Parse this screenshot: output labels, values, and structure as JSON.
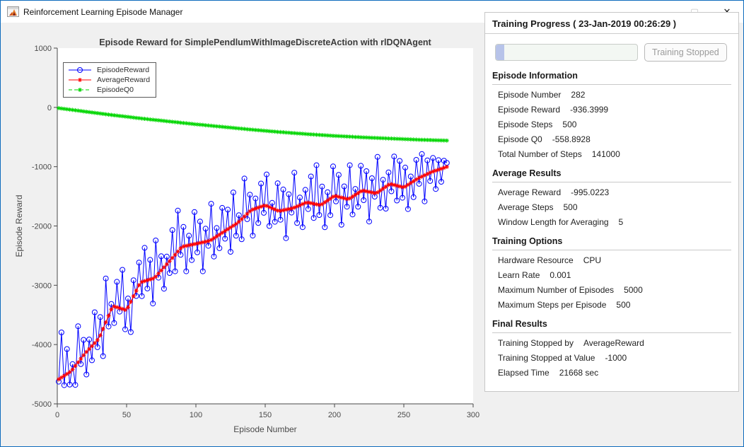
{
  "window": {
    "title": "Reinforcement Learning Episode Manager",
    "controls": {
      "minimize": "—",
      "maximize": "▢",
      "close": "✕"
    }
  },
  "chart_data": {
    "type": "line",
    "title": "Episode Reward for SimplePendlumWithImageDiscreteAction with rlDQNAgent",
    "xlabel": "Episode Number",
    "ylabel": "Episode Reward",
    "xlim": [
      0,
      300
    ],
    "ylim": [
      -5000,
      1000
    ],
    "xticks": [
      0,
      50,
      100,
      150,
      200,
      250,
      300
    ],
    "yticks": [
      1000,
      0,
      -1000,
      -2000,
      -3000,
      -4000,
      -5000
    ],
    "legend_position": "top-left",
    "x_start": 1,
    "x_step": 2,
    "series": [
      {
        "name": "EpisodeReward",
        "color": "#0000ff",
        "marker": "circle",
        "line": "solid",
        "values": [
          -4625,
          -3795,
          -4685,
          -4075,
          -4675,
          -4330,
          -4680,
          -3690,
          -4330,
          -3920,
          -4505,
          -3915,
          -4265,
          -3455,
          -4045,
          -3535,
          -4195,
          -2885,
          -3695,
          -3315,
          -3637,
          -2941,
          -3445,
          -2739,
          -3743,
          -3223,
          -3789,
          -2915,
          -3181,
          -2617,
          -3183,
          -2369,
          -3055,
          -2571,
          -3307,
          -2244,
          -2872,
          -2510,
          -3058,
          -2516,
          -2793,
          -2069,
          -2765,
          -1741,
          -2487,
          -2015,
          -2765,
          -2165,
          -2575,
          -1765,
          -2445,
          -1925,
          -2765,
          -2045,
          -2335,
          -1625,
          -2515,
          -2035,
          -2375,
          -1695,
          -2215,
          -1725,
          -2435,
          -1435,
          -2165,
          -1818,
          -2224,
          -1200,
          -1886,
          -1472,
          -2162,
          -1536,
          -1950,
          -1284,
          -1778,
          -1130,
          -2000,
          -1610,
          -1930,
          -1280,
          -1895,
          -1385,
          -2205,
          -1465,
          -1775,
          -1100,
          -1950,
          -1520,
          -2020,
          -1390,
          -1715,
          -1165,
          -1865,
          -975,
          -1815,
          -1334,
          -2022,
          -1430,
          -1818,
          -996,
          -1586,
          -1138,
          -1980,
          -1332,
          -1674,
          -975,
          -1805,
          -1375,
          -1675,
          -985,
          -1565,
          -1075,
          -1925,
          -1195,
          -1505,
          -834,
          -1692,
          -1220,
          -1708,
          -1096,
          -1416,
          -828,
          -1570,
          -902,
          -1524,
          -1015,
          -1715,
          -1165,
          -1515,
          -885,
          -1289,
          -787,
          -1585,
          -893,
          -1241,
          -852,
          -1376,
          -890,
          -1255,
          -899,
          -936
        ]
      },
      {
        "name": "AverageReward",
        "color": "#ff0000",
        "marker": "asterisk",
        "line": "solid",
        "values": [
          -4585,
          -4555,
          -4525,
          -4495,
          -4465,
          -4420,
          -4360,
          -4300,
          -4240,
          -4180,
          -4125,
          -4075,
          -4025,
          -3975,
          -3925,
          -3845,
          -3735,
          -3625,
          -3515,
          -3405,
          -3357,
          -3371,
          -3385,
          -3399,
          -3413,
          -3373,
          -3279,
          -3185,
          -3091,
          -2997,
          -2943,
          -2929,
          -2915,
          -2901,
          -2887,
          -2854,
          -2802,
          -2750,
          -2698,
          -2646,
          -2593,
          -2539,
          -2485,
          -2431,
          -2377,
          -2345,
          -2335,
          -2325,
          -2315,
          -2305,
          -2295,
          -2285,
          -2275,
          -2265,
          -2255,
          -2235,
          -2205,
          -2175,
          -2145,
          -2115,
          -2085,
          -2055,
          -2025,
          -1995,
          -1965,
          -1928,
          -1884,
          -1840,
          -1796,
          -1752,
          -1722,
          -1706,
          -1690,
          -1674,
          -1658,
          -1660,
          -1680,
          -1700,
          -1720,
          -1740,
          -1745,
          -1735,
          -1725,
          -1715,
          -1705,
          -1690,
          -1670,
          -1650,
          -1630,
          -1610,
          -1605,
          -1615,
          -1625,
          -1635,
          -1645,
          -1634,
          -1602,
          -1570,
          -1538,
          -1506,
          -1496,
          -1508,
          -1520,
          -1532,
          -1544,
          -1535,
          -1505,
          -1475,
          -1445,
          -1415,
          -1405,
          -1415,
          -1425,
          -1435,
          -1445,
          -1434,
          -1402,
          -1370,
          -1338,
          -1306,
          -1296,
          -1308,
          -1320,
          -1332,
          -1344,
          -1335,
          -1305,
          -1275,
          -1245,
          -1215,
          -1189,
          -1167,
          -1145,
          -1123,
          -1101,
          -1082,
          -1066,
          -1050,
          -1035,
          -1019,
          -1003
        ]
      },
      {
        "name": "EpisodeQ0",
        "color": "#00d600",
        "marker": "asterisk",
        "line": "dashed",
        "values": [
          -13,
          -19,
          -25,
          -31,
          -37,
          -43,
          -49,
          -55,
          -61,
          -67,
          -73,
          -79,
          -85,
          -91,
          -97,
          -103,
          -109,
          -115,
          -121,
          -127,
          -133,
          -138,
          -144,
          -149,
          -155,
          -160,
          -166,
          -171,
          -177,
          -182,
          -188,
          -193,
          -198,
          -203,
          -208,
          -213,
          -218,
          -223,
          -228,
          -233,
          -238,
          -243,
          -248,
          -253,
          -258,
          -263,
          -268,
          -273,
          -278,
          -283,
          -287,
          -292,
          -296,
          -301,
          -305,
          -310,
          -314,
          -319,
          -323,
          -328,
          -332,
          -337,
          -341,
          -346,
          -350,
          -355,
          -359,
          -364,
          -368,
          -373,
          -377,
          -381,
          -385,
          -389,
          -393,
          -397,
          -401,
          -405,
          -409,
          -413,
          -417,
          -420,
          -424,
          -427,
          -431,
          -434,
          -438,
          -441,
          -445,
          -448,
          -452,
          -455,
          -458,
          -461,
          -464,
          -467,
          -470,
          -473,
          -476,
          -479,
          -481,
          -484,
          -486,
          -489,
          -491,
          -494,
          -496,
          -499,
          -501,
          -504,
          -506,
          -508,
          -510,
          -512,
          -514,
          -516,
          -518,
          -520,
          -522,
          -524,
          -526,
          -528,
          -530,
          -532,
          -534,
          -536,
          -538,
          -540,
          -542,
          -544,
          -546,
          -547,
          -548,
          -550,
          -551,
          -553,
          -554,
          -555,
          -557,
          -558,
          -559
        ]
      }
    ]
  },
  "panel": {
    "header": "Training Progress ( 23-Jan-2019 00:26:29 )",
    "progress_percent": 6,
    "stop_button_label": "Training Stopped",
    "sections": [
      {
        "title": "Episode Information",
        "items": [
          {
            "label": "Episode Number",
            "value": "282"
          },
          {
            "label": "Episode Reward",
            "value": "-936.3999"
          },
          {
            "label": "Episode Steps",
            "value": "500"
          },
          {
            "label": "Episode Q0",
            "value": "-558.8928"
          },
          {
            "label": "Total Number of Steps",
            "value": "141000"
          }
        ]
      },
      {
        "title": "Average Results",
        "items": [
          {
            "label": "Average Reward",
            "value": "-995.0223"
          },
          {
            "label": "Average Steps",
            "value": "500"
          },
          {
            "label": "Window Length for Averaging",
            "value": "5"
          }
        ]
      },
      {
        "title": "Training Options",
        "items": [
          {
            "label": "Hardware Resource",
            "value": "CPU"
          },
          {
            "label": "Learn Rate",
            "value": "0.001"
          },
          {
            "label": "Maximum Number of Episodes",
            "value": "5000"
          },
          {
            "label": "Maximum Steps per Episode",
            "value": "500"
          }
        ]
      },
      {
        "title": "Final Results",
        "items": [
          {
            "label": "Training Stopped by",
            "value": "AverageReward"
          },
          {
            "label": "Training Stopped at Value",
            "value": "-1000"
          },
          {
            "label": "Elapsed Time",
            "value": "21668 sec"
          }
        ]
      }
    ]
  }
}
